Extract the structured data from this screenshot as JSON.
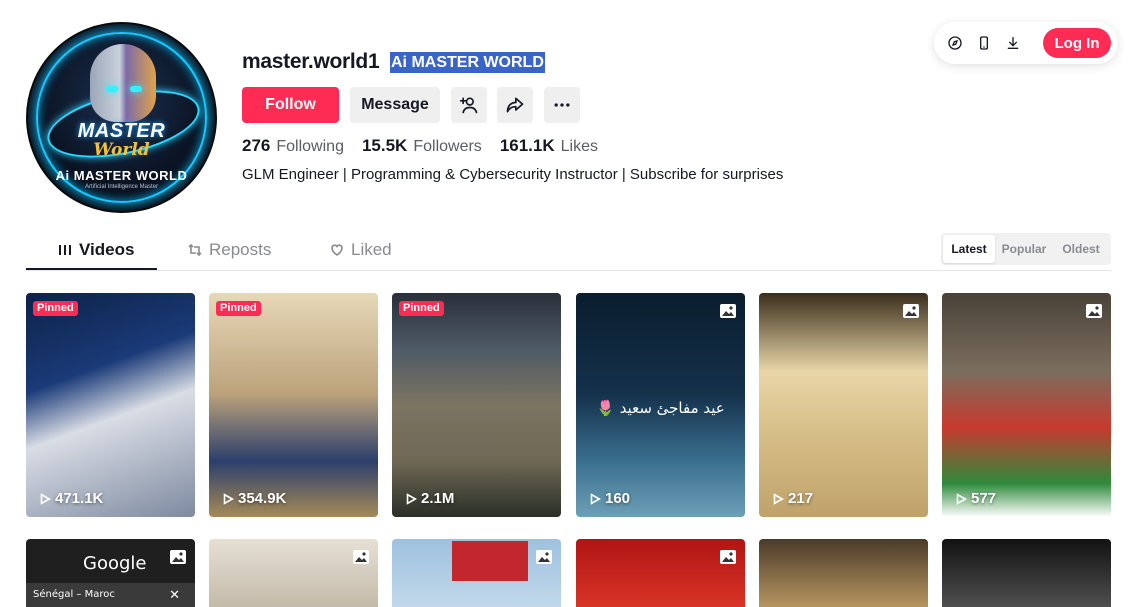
{
  "profile": {
    "username": "master.world1",
    "nickname": "Ai MASTER WORLD",
    "avatar_text": {
      "line1": "MASTER",
      "line2": "World",
      "line3": "Ai MASTER WORLD",
      "line4": "Artificial Intelligence Master"
    },
    "follow_label": "Follow",
    "message_label": "Message",
    "stats": [
      {
        "num": "276",
        "label": "Following"
      },
      {
        "num": "15.5K",
        "label": "Followers"
      },
      {
        "num": "161.1K",
        "label": "Likes"
      }
    ],
    "bio": "GLM Engineer | Programming & Cybersecurity Instructor | Subscribe for surprises"
  },
  "topbar": {
    "login_label": "Log In",
    "icons": [
      "compass-icon",
      "mobile-icon",
      "download-icon"
    ]
  },
  "tabs": [
    {
      "label": "Videos",
      "icon": "grid-icon"
    },
    {
      "label": "Reposts",
      "icon": "repost-icon"
    },
    {
      "label": "Liked",
      "icon": "heart-icon"
    }
  ],
  "sort": [
    "Latest",
    "Popular",
    "Oldest"
  ],
  "videos": [
    {
      "pinned": "Pinned",
      "views": "471.1K"
    },
    {
      "pinned": "Pinned",
      "views": "354.9K"
    },
    {
      "pinned": "Pinned",
      "views": "2.1M"
    },
    {
      "views": "160",
      "caption": "🌷 عيد مفاجئ سعيد"
    },
    {
      "views": "217"
    },
    {
      "views": "577"
    }
  ],
  "videos_row2": [
    {
      "caption_top": "Google",
      "caption_bottom": "Sénégal – Maroc"
    },
    {},
    {},
    {},
    {},
    {}
  ],
  "colors": {
    "accent": "#fe2c55",
    "highlight": "#3a64c8"
  }
}
